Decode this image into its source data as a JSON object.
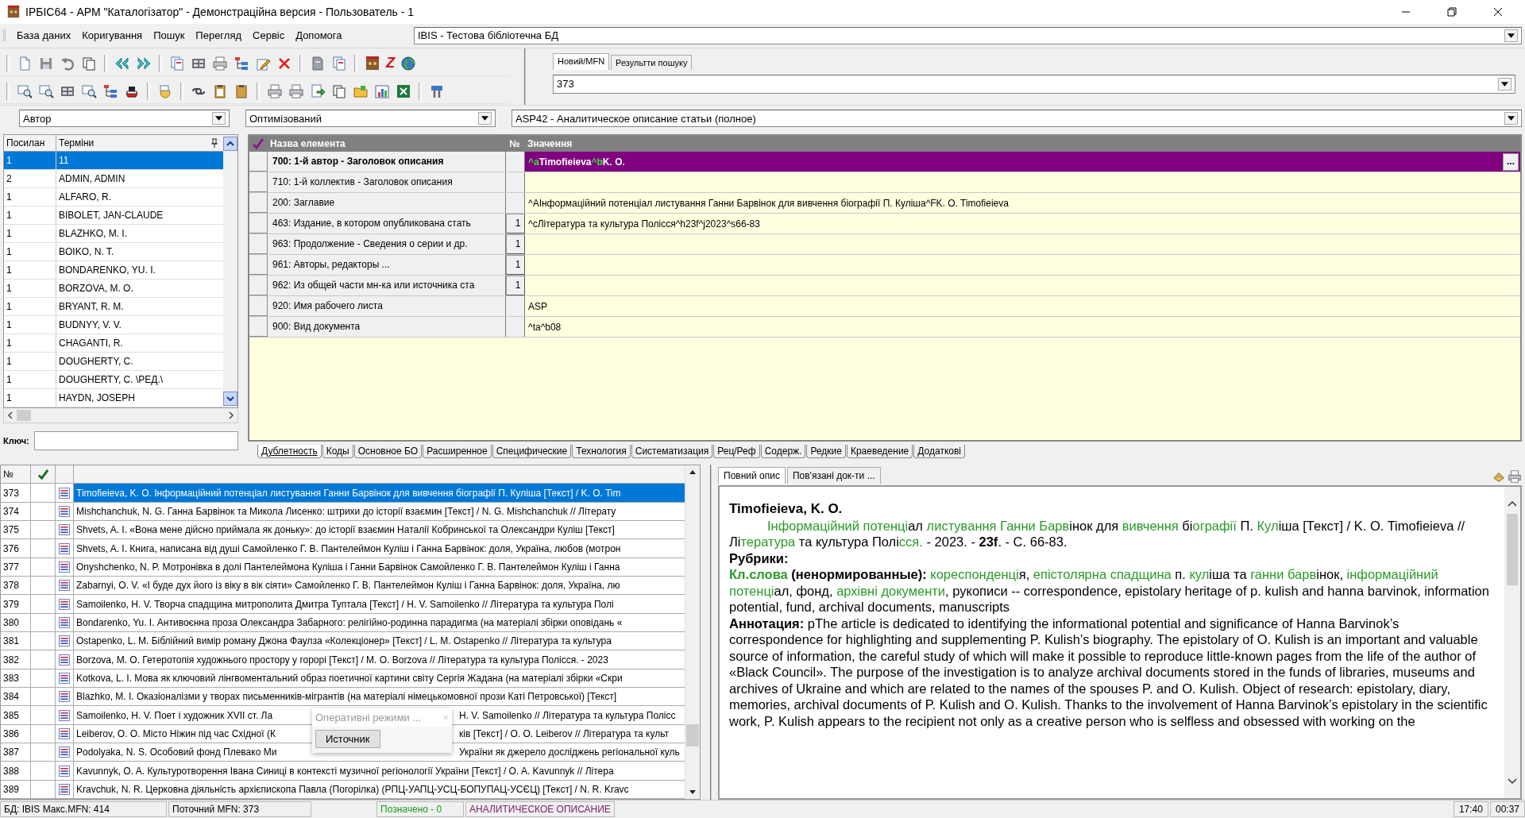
{
  "window": {
    "title": "IРБIС64 - АРМ \"Каталогізатор\" - Демонстраційна версия - Пользователь - 1"
  },
  "menu": [
    "База даних",
    "Коригування",
    "Пошук",
    "Перегляд",
    "Сервіс",
    "Допомога"
  ],
  "database_combo": {
    "value": "IBIS - Тестова бібліотечна БД"
  },
  "toolbar_letter": "Z",
  "search_tabs": [
    {
      "label": "Новий/MFN",
      "selected": true
    },
    {
      "label": "Результти пошуку",
      "selected": false
    }
  ],
  "mfn_field": {
    "value": "373"
  },
  "combos": [
    {
      "value": "Автор"
    },
    {
      "value": "Оптимізований"
    },
    {
      "value": "ASP42 - Аналитическое описание статьи (полное)"
    }
  ],
  "terms": {
    "columns": [
      "Посилан",
      "Терміни"
    ],
    "rows": [
      {
        "count": "1",
        "term": "11",
        "selected": true
      },
      {
        "count": "2",
        "term": "ADMIN, ADMIN",
        "selected": false
      },
      {
        "count": "1",
        "term": "ALFARO, R.",
        "selected": false
      },
      {
        "count": "1",
        "term": "BIBOLET, JAN-CLAUDE",
        "selected": false
      },
      {
        "count": "1",
        "term": "BLAZHKO, M. I.",
        "selected": false
      },
      {
        "count": "1",
        "term": "BOIKO, N. T.",
        "selected": false
      },
      {
        "count": "1",
        "term": "BONDARENKO, YU. I.",
        "selected": false
      },
      {
        "count": "1",
        "term": "BORZOVA, M. O.",
        "selected": false
      },
      {
        "count": "1",
        "term": "BRYANT, R. M.",
        "selected": false
      },
      {
        "count": "1",
        "term": "BUDNYY, V. V.",
        "selected": false
      },
      {
        "count": "1",
        "term": "CHAGANTI, R.",
        "selected": false
      },
      {
        "count": "1",
        "term": "DOUGHERTY, C.",
        "selected": false
      },
      {
        "count": "1",
        "term": "DOUGHERTY, C. \\РЕД.\\",
        "selected": false
      },
      {
        "count": "1",
        "term": "HAYDN, JOSEPH",
        "selected": false
      }
    ],
    "key_label": "Ключ:"
  },
  "editor": {
    "columns": [
      "Назва елемента",
      "№",
      "Значення"
    ],
    "edit_button": "...",
    "rows": [
      {
        "name": "700: 1-й  автор - Заголовок описания",
        "selected": true,
        "value": [
          {
            "text": "^a",
            "marker": true
          },
          {
            "text": "Timofieieva",
            "marker": false
          },
          {
            "text": "^b",
            "marker": true
          },
          {
            "text": "K. O.",
            "marker": false
          }
        ]
      },
      {
        "name": "710: 1-й коллектив - Заголовок описания",
        "selected": false
      },
      {
        "name": "200: Заглавие",
        "selected": false,
        "value": [
          {
            "text": "^AІнформаційний потенціал листування  Ганни Барвінок для вивчення біографії П. Куліша^FK. O. Timofieieva",
            "marker": false
          }
        ]
      },
      {
        "name": "463: Издание, в котором опубликована стать",
        "selected": false,
        "num": "1",
        "value": [
          {
            "text": "^cЛітература та культура Полісся^h23f^j2023^s66-83",
            "marker": false
          }
        ]
      },
      {
        "name": "963: Продолжение - Сведения о серии и др.",
        "selected": false,
        "num": "1"
      },
      {
        "name": "961: Авторы, редакторы ...",
        "selected": false,
        "num": "1"
      },
      {
        "name": "962: Из общей части мн-ка или источника ста",
        "selected": false,
        "num": "1"
      },
      {
        "name": "920: Имя рабочего листа",
        "selected": false,
        "value": [
          {
            "text": "ASP",
            "marker": false
          }
        ]
      },
      {
        "name": "900: Вид документа",
        "selected": false,
        "value": [
          {
            "text": "^ta^b08",
            "marker": false
          }
        ]
      }
    ],
    "tabs": [
      {
        "label": "Дублетность",
        "selected": true
      },
      {
        "label": "Коды",
        "selected": false
      },
      {
        "label": "Основное БО",
        "selected": false
      },
      {
        "label": "Расширенное",
        "selected": false
      },
      {
        "label": "Специфические",
        "selected": false
      },
      {
        "label": "Технология",
        "selected": false
      },
      {
        "label": "Систематизация",
        "selected": false
      },
      {
        "label": "Рец/Реф",
        "selected": false
      },
      {
        "label": "Содерж.",
        "selected": false
      },
      {
        "label": "Редкие",
        "selected": false
      },
      {
        "label": "Краеведение",
        "selected": false
      },
      {
        "label": "Додаткові",
        "selected": false
      }
    ]
  },
  "records": {
    "number_header": "№",
    "rows": [
      {
        "n": "373",
        "selected": true,
        "text": "Timofieieva, K. O. Інформаційний потенціал листування  Ганни Барвінок для вивчення біографії П. Куліша [Текст]  / K. O. Tim"
      },
      {
        "n": "374",
        "selected": false,
        "text": "Mishchanchuk, N. G. Ганна Барвінок та Микола Лисенко:  штрихи до історії взаємин [Текст]  / N. G. Mishchanchuk // Літерату"
      },
      {
        "n": "375",
        "selected": false,
        "text": "Shvets, A. I. «Вона мене дійсно приймала як доньку»: до історії  взаємин Наталії Кобринської та Олександри Куліш [Текст]"
      },
      {
        "n": "376",
        "selected": false,
        "text": "Shvets, A. I. Книга, написана від душі Самойленко Г. В. Пантелеймон Куліш і Ганна Барвінок: доля, Україна, любов (мотрон"
      },
      {
        "n": "377",
        "selected": false,
        "text": "Onyshchenko, N. P. Мотронівка в долі Пантелеймона Куліша і  Ганни Барвінок Самойленко Г. В. Пантелеймон Куліш і Ганна"
      },
      {
        "n": "378",
        "selected": false,
        "text": "Zabarnyi, O. V. «І буде дух його із віку в вік сіяти» Самойленко Г. В. Пантелеймон Куліш і Ганна Барвінок: доля,  Україна, лю"
      },
      {
        "n": "379",
        "selected": false,
        "text": "Samoilenko, H. V. Творча спадщина митрополита Дмитра Туптала [Текст]  / H. V. Samoilenko // Література та культура Полі"
      },
      {
        "n": "380",
        "selected": false,
        "text": "Bondarenko, Yu. I. Антивоєнна проза Олександра Забарного: релігійно-родинна парадигма (на матеріалі збірки оповідань «"
      },
      {
        "n": "381",
        "selected": false,
        "text": "Ostapenko, L. M. Біблійний вимір роману Джона Фаулза «Колекціонер» [Текст]  / L. M. Ostapenko // Література та культура"
      },
      {
        "n": "382",
        "selected": false,
        "text": "Borzova, M. O. Гетеротопія художнього простору у горорі [Текст]  / M. O. Borzova // Література та культура Полісся. - 2023"
      },
      {
        "n": "383",
        "selected": false,
        "text": "Kotkova, L. I. Мова як ключовий лінгвоментальний образ поетичної картини світу Сергія Жадана (на матеріалі збірки «Скри"
      },
      {
        "n": "384",
        "selected": false,
        "text": "Blazhko, M. I. Оказіоналізми у творах письменників-мігрантів (на матеріалі німецькомовної прози Каті Петровської) [Текст]"
      },
      {
        "n": "385",
        "selected": false,
        "text": "Samoilenko, H. V. Поет і художник XVII ст. Ла",
        "tail": "H. V. Samoilenko // Література та культура Полісс"
      },
      {
        "n": "386",
        "selected": false,
        "text": "Leiberov, O. O. Місто Ніжин під час Східної (К",
        "tail": "ків [Текст]  / O. O. Leiberov // Література та культ"
      },
      {
        "n": "387",
        "selected": false,
        "text": "Podolyaka, N. S. Особовий фонд Плевако Ми",
        "tail": "України як джерело досліджень регіональної куль"
      },
      {
        "n": "388",
        "selected": false,
        "text": "Kavunnyk, O. A. Культуротворення Івана Синиці в контексті музичної регіонології України [Текст]  / O. A. Kavunnyk // Літера"
      },
      {
        "n": "389",
        "selected": false,
        "text": "Kravchuk, N. R. Церковна діяльність архієпископа Павла (Погорілка) (РПЦ-УАПЦ-УСЦ-БОПУПАЦ-УСЄЦ) [Текст]  / N. R. Kravc"
      }
    ]
  },
  "popup": {
    "title": "Оперативні режими ...",
    "close": "×",
    "button": "Источник"
  },
  "description": {
    "tabs": [
      {
        "label": "Повний опис",
        "selected": true
      },
      {
        "label": "Пов'язані док-ти ...",
        "selected": false
      }
    ],
    "author": "Timofieieva, K. O.",
    "body": [
      {
        "text": "Інформаційний потенці",
        "highlight": true,
        "bold": false
      },
      {
        "text": "ал ",
        "highlight": false,
        "bold": false
      },
      {
        "text": "листування Ганни Барв",
        "highlight": true,
        "bold": false
      },
      {
        "text": "інок для ",
        "highlight": false,
        "bold": false
      },
      {
        "text": "вивчення",
        "highlight": true,
        "bold": false
      },
      {
        "text": " бі",
        "highlight": false,
        "bold": false
      },
      {
        "text": "ографії",
        "highlight": true,
        "bold": false
      },
      {
        "text": " П. ",
        "highlight": false,
        "bold": false
      },
      {
        "text": "Кул",
        "highlight": true,
        "bold": false
      },
      {
        "text": "іша [Текст] / K. O. Timofieieva // Лі",
        "highlight": false,
        "bold": false
      },
      {
        "text": "тература",
        "highlight": true,
        "bold": false
      },
      {
        "text": " та культура Полі",
        "highlight": false,
        "bold": false
      },
      {
        "text": "сся.",
        "highlight": true,
        "bold": false
      },
      {
        "text": " - 2023. - ",
        "highlight": false,
        "bold": false
      },
      {
        "text": "23f",
        "highlight": false,
        "bold": true
      },
      {
        "text": ". - С. 66-83.",
        "highlight": false,
        "bold": false
      }
    ],
    "rubrics": "Рубрики:",
    "keywords": [
      {
        "text": "Кл.слова",
        "highlight": true,
        "bold": true
      },
      {
        "text": " (ненормированные): ",
        "highlight": false,
        "bold": true
      },
      {
        "text": "кореспонденці",
        "highlight": true,
        "bold": false
      },
      {
        "text": "я, ",
        "highlight": false,
        "bold": false
      },
      {
        "text": "епістолярна спадщина",
        "highlight": true,
        "bold": false
      },
      {
        "text": " п. ",
        "highlight": false,
        "bold": false
      },
      {
        "text": "кул",
        "highlight": true,
        "bold": false
      },
      {
        "text": "іша та ",
        "highlight": false,
        "bold": false
      },
      {
        "text": "ганни барв",
        "highlight": true,
        "bold": false
      },
      {
        "text": "інок, ",
        "highlight": false,
        "bold": false
      },
      {
        "text": "інформаційний потенці",
        "highlight": true,
        "bold": false
      },
      {
        "text": "ал, фонд, ",
        "highlight": false,
        "bold": false
      },
      {
        "text": "архівні документи",
        "highlight": true,
        "bold": false
      },
      {
        "text": ", рукописи -- correspondence, epistolary heritage of p. kulish and hanna barvinok, information potential, fund, archival documents, manuscripts",
        "highlight": false,
        "bold": false
      }
    ],
    "annotation": "**Аннотация:** pThe article is dedicated to identifying the informational potential and significance of Hanna Barvinok’s correspondence for highlighting and supplementing P. Kulish’s biography. The epistolary of O. Kulish is an important and valuable source of information, the careful study of which will make it possible to reproduce little-known pages from the life of the author of «Black Council». The purpose of the investigation is to analyze archival documents stored in the funds of libraries, museums and archives of Ukraine and which are related to the names of the spouses P. and O. Kulish. Object of research: epistolary, diary, memories, archival documents of P. Kulish and O. Kulish. Thanks to the involvement of Hanna Barvinok’s epistolary in the scientific work, P. Kulish appears to the recipient not only as a creative person who is selfless and obsessed with working on the"
  },
  "status_bar": [
    {
      "text": "БД: IBIS Макс.MFN: 414",
      "color": "#000000"
    },
    {
      "text": "Поточний MFN: 373",
      "color": "#000000"
    },
    {
      "text": "Позначено - 0",
      "color": "#1a9a1a"
    },
    {
      "text": "АНАЛИТИЧЕСКОЕ ОПИСАНИЕ",
      "color": "#80206a"
    }
  ],
  "clock": [
    "17:40",
    "00:37"
  ]
}
